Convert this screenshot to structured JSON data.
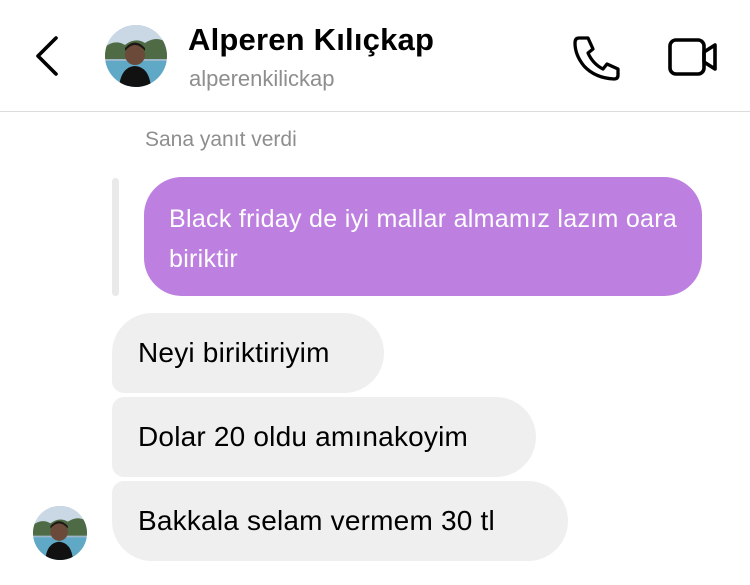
{
  "header": {
    "title": "Alperen Kılıçkap",
    "username": "alperenkilickap",
    "icons": {
      "back": "chevron-left-icon",
      "phone": "phone-icon",
      "video": "video-camera-icon",
      "avatar": "profile-photo"
    }
  },
  "conversation": {
    "reply_caption": "Sana yanıt verdi",
    "quoted_message": "Black friday de iyi mallar almamız lazım oara biriktir",
    "messages": [
      {
        "text": "Neyi biriktiriyim"
      },
      {
        "text": "Dolar 20 oldu amınakoyim"
      },
      {
        "text": "Bakkala selam vermem 30 tl"
      }
    ]
  },
  "colors": {
    "quoted_bubble": "#bd80e0",
    "incoming_bubble": "#efefef",
    "secondary_text": "#8e8e8e",
    "divider": "#dcdcdc"
  }
}
